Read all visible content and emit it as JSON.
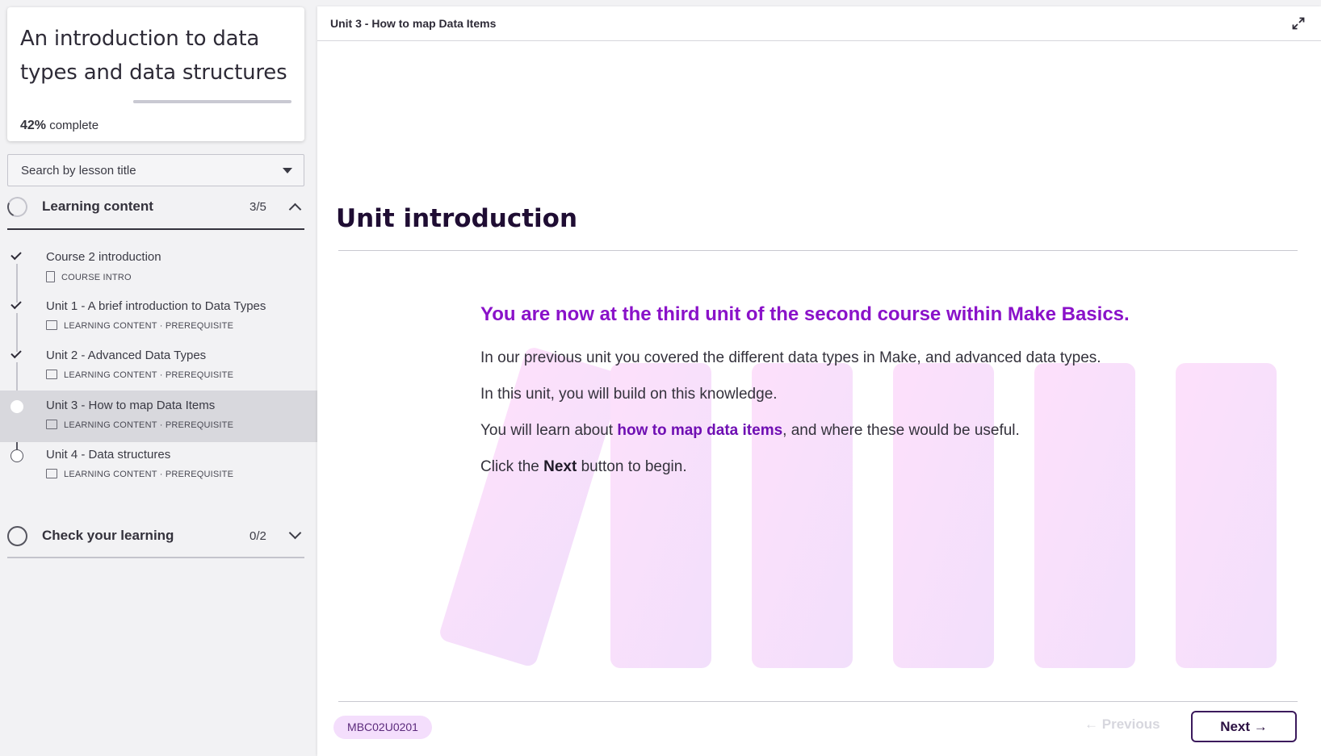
{
  "course": {
    "title": "An introduction to data types and data structures",
    "progress_percent": 42,
    "progress_value": "42%",
    "progress_suffix": " complete"
  },
  "search": {
    "placeholder": "Search by lesson title"
  },
  "sections": [
    {
      "label": "Learning content",
      "count": "3/5",
      "expanded": true
    },
    {
      "label": "Check your learning",
      "count": "0/2",
      "expanded": false
    }
  ],
  "lessons": [
    {
      "title": "Course 2 introduction",
      "meta": "COURSE INTRO",
      "status": "done"
    },
    {
      "title": "Unit 1 - A brief introduction to Data Types",
      "meta": "LEARNING CONTENT · PREREQUISITE",
      "status": "done"
    },
    {
      "title": "Unit 2 - Advanced Data Types",
      "meta": "LEARNING CONTENT · PREREQUISITE",
      "status": "done"
    },
    {
      "title": "Unit 3 - How to map Data Items",
      "meta": "LEARNING CONTENT · PREREQUISITE",
      "status": "current"
    },
    {
      "title": "Unit 4 - Data structures",
      "meta": "LEARNING CONTENT · PREREQUISITE",
      "status": "todo"
    }
  ],
  "main": {
    "breadcrumb": "Unit 3 - How to map Data Items",
    "heading": "Unit introduction",
    "lead": "You are now at the third unit of the second course within Make Basics.",
    "p1": "In our previous unit you covered the different data types in Make, and advanced data types.",
    "p2": "In this unit, you will build on this knowledge.",
    "p3_pre": "You will learn about ",
    "p3_link": "how to map data items",
    "p3_post": ", and where these would be useful.",
    "p4_pre": "Click the ",
    "p4_bold": "Next",
    "p4_post": " button to begin.",
    "code": "MBC02U0201",
    "prev_label": "Previous",
    "next_label": "Next"
  },
  "colors": {
    "accent_purple": "#8a12c9",
    "link_purple": "#6f0fb3",
    "heading_dark": "#1f0d33",
    "chip_bg": "#f4defc"
  },
  "icons": {
    "check": "check-icon",
    "expand": "expand-icon",
    "caret": "caret-down-icon",
    "arrow_left": "arrow-left-icon",
    "arrow_right": "arrow-right-icon"
  }
}
